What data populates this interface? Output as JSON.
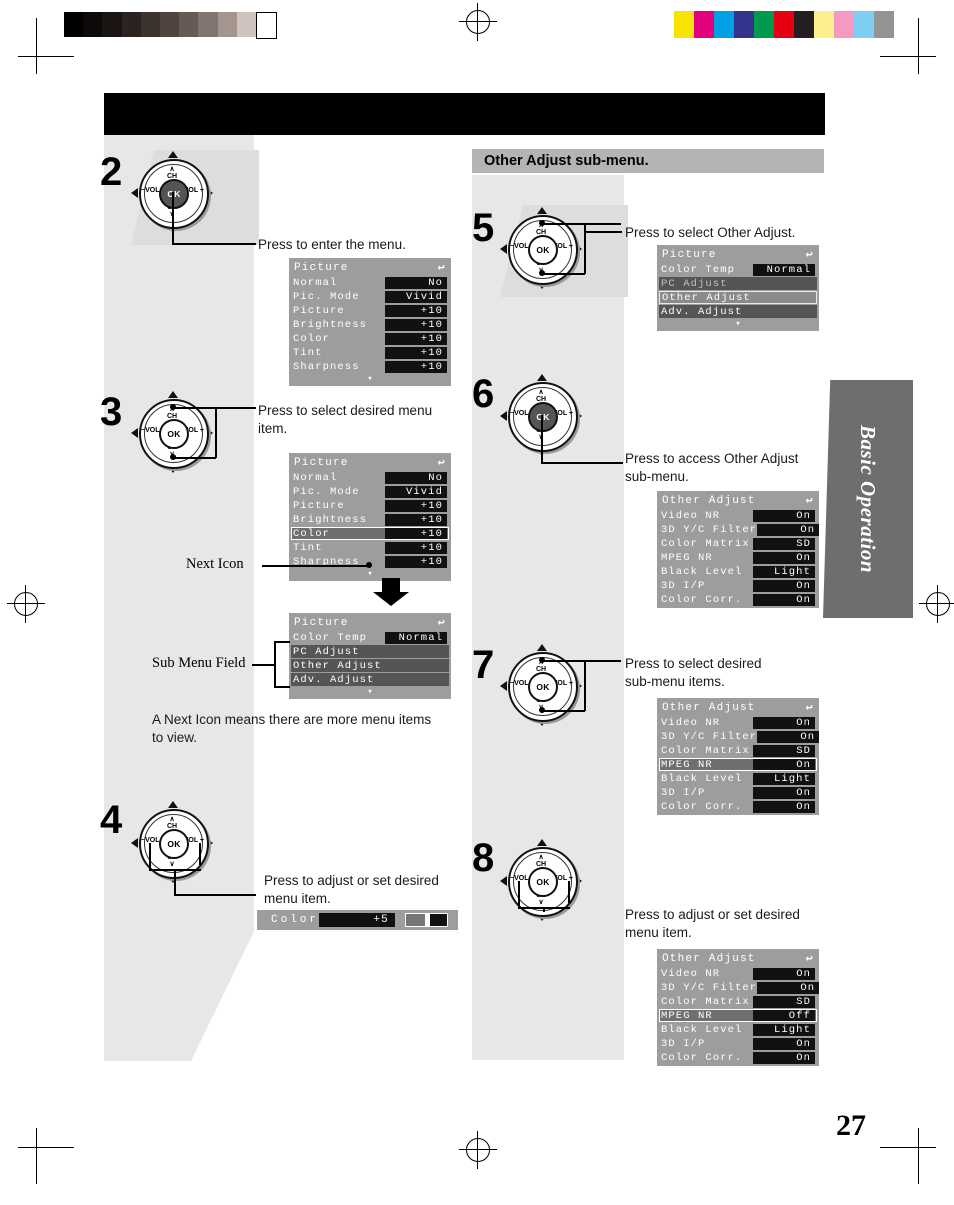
{
  "page": {
    "number": "27",
    "side_tab": "Basic Operation",
    "section_header": "Other Adjust sub-menu."
  },
  "calibration": {
    "gray_steps": [
      "#000000",
      "#0d0a09",
      "#1a1512",
      "#2b2320",
      "#3d332e",
      "#4f4440",
      "#665a55",
      "#827470",
      "#a4968f",
      "#cfc3bd",
      "#ffffff"
    ],
    "color_steps": [
      "#f7e300",
      "#e3007f",
      "#00a0e4",
      "#33358d",
      "#009a4e",
      "#e60012",
      "#231f20",
      "#fbf08c",
      "#f49ac1",
      "#7ecef4",
      "#949494"
    ]
  },
  "steps": [
    {
      "id": "step2",
      "number": "2",
      "instruction": "Press to enter the menu.",
      "remote_active": "ok"
    },
    {
      "id": "step3",
      "number": "3",
      "instruction": "Press to select desired menu\nitem.",
      "remote_active": "ch"
    },
    {
      "id": "step4",
      "number": "4",
      "instruction": "Press to adjust or set desired\nmenu item.",
      "remote_active": "vol"
    },
    {
      "id": "step5",
      "number": "5",
      "instruction": "Press to select Other Adjust.",
      "remote_active": "ch"
    },
    {
      "id": "step6",
      "number": "6",
      "instruction": "Press to access Other Adjust\nsub-menu.",
      "remote_active": "ok"
    },
    {
      "id": "step7",
      "number": "7",
      "instruction": "Press to select desired\nsub-menu items.",
      "remote_active": "ch"
    },
    {
      "id": "step8",
      "number": "8",
      "instruction": "Press to adjust or set desired\nmenu item.",
      "remote_active": "vol"
    }
  ],
  "callouts": {
    "next_icon": "Next Icon",
    "sub_menu_field": "Sub Menu Field",
    "next_icon_note": "A Next Icon means there are more menu items\nto view."
  },
  "remote": {
    "ok_label": "OK",
    "ch_up": "CH",
    "ch_up_caret": "∧",
    "ch_down": "CH",
    "ch_down_caret": "∨",
    "vol_minus": "−VOL",
    "vol_plus": "VOL +"
  },
  "osd": {
    "back_icon": "↩",
    "next_icon": "▾",
    "picture_main": {
      "title": "Picture",
      "rows": [
        {
          "key": "Normal",
          "value": "No",
          "state": "normal"
        },
        {
          "key": "Pic. Mode",
          "value": "Vivid",
          "state": "normal"
        },
        {
          "key": "Picture",
          "value": "+10",
          "state": "normal"
        },
        {
          "key": "Brightness",
          "value": "+10",
          "state": "normal"
        },
        {
          "key": "Color",
          "value": "+10",
          "state": "normal"
        },
        {
          "key": "Tint",
          "value": "+10",
          "state": "normal"
        },
        {
          "key": "Sharpness",
          "value": "+10",
          "state": "normal"
        }
      ]
    },
    "picture_main_selected": {
      "title": "Picture",
      "rows": [
        {
          "key": "Normal",
          "value": "No",
          "state": "normal"
        },
        {
          "key": "Pic. Mode",
          "value": "Vivid",
          "state": "normal"
        },
        {
          "key": "Picture",
          "value": "+10",
          "state": "normal"
        },
        {
          "key": "Brightness",
          "value": "+10",
          "state": "normal"
        },
        {
          "key": "Color",
          "value": "+10",
          "state": "selected"
        },
        {
          "key": "Tint",
          "value": "+10",
          "state": "normal"
        },
        {
          "key": "Sharpness",
          "value": "+10",
          "state": "normal"
        }
      ]
    },
    "picture_sub": {
      "title": "Picture",
      "rows": [
        {
          "key": "Color Temp",
          "value": "Normal",
          "state": "normal"
        },
        {
          "key": "PC Adjust",
          "value": "",
          "state": "field"
        },
        {
          "key": "Other Adjust",
          "value": "",
          "state": "field"
        },
        {
          "key": "Adv. Adjust",
          "value": "",
          "state": "field"
        }
      ]
    },
    "picture_sub_other_selected": {
      "title": "Picture",
      "rows": [
        {
          "key": "Color Temp",
          "value": "Normal",
          "state": "normal"
        },
        {
          "key": "PC Adjust",
          "value": "",
          "state": "dim"
        },
        {
          "key": "Other Adjust",
          "value": "",
          "state": "field-selected"
        },
        {
          "key": "Adv. Adjust",
          "value": "",
          "state": "field"
        }
      ]
    },
    "other_adjust": {
      "title": "Other Adjust",
      "rows": [
        {
          "key": "Video NR",
          "value": "On",
          "state": "normal"
        },
        {
          "key": "3D Y/C Filter",
          "value": "On",
          "state": "normal"
        },
        {
          "key": "Color Matrix",
          "value": "SD",
          "state": "normal"
        },
        {
          "key": "MPEG NR",
          "value": "On",
          "state": "normal"
        },
        {
          "key": "Black Level",
          "value": "Light",
          "state": "normal"
        },
        {
          "key": "3D I/P",
          "value": "On",
          "state": "normal"
        },
        {
          "key": "Color Corr.",
          "value": "On",
          "state": "normal"
        }
      ]
    },
    "other_adjust_selected": {
      "title": "Other Adjust",
      "rows": [
        {
          "key": "Video NR",
          "value": "On",
          "state": "normal"
        },
        {
          "key": "3D Y/C Filter",
          "value": "On",
          "state": "normal"
        },
        {
          "key": "Color Matrix",
          "value": "SD",
          "state": "normal"
        },
        {
          "key": "MPEG NR",
          "value": "On",
          "state": "selected"
        },
        {
          "key": "Black Level",
          "value": "Light",
          "state": "normal"
        },
        {
          "key": "3D I/P",
          "value": "On",
          "state": "normal"
        },
        {
          "key": "Color Corr.",
          "value": "On",
          "state": "normal"
        }
      ]
    },
    "other_adjust_changed": {
      "title": "Other Adjust",
      "rows": [
        {
          "key": "Video NR",
          "value": "On",
          "state": "normal"
        },
        {
          "key": "3D Y/C Filter",
          "value": "On",
          "state": "normal"
        },
        {
          "key": "Color Matrix",
          "value": "SD",
          "state": "normal"
        },
        {
          "key": "MPEG NR",
          "value": "Off",
          "state": "selected"
        },
        {
          "key": "Black Level",
          "value": "Light",
          "state": "normal"
        },
        {
          "key": "3D I/P",
          "value": "On",
          "state": "normal"
        },
        {
          "key": "Color Corr.",
          "value": "On",
          "state": "normal"
        }
      ]
    },
    "color_slider": {
      "label": "Color",
      "value": "+5",
      "position_pct": 46
    }
  },
  "colors": {
    "osd_background": "#9d9d9d",
    "osd_value_bg": "#111111",
    "osd_field_bg": "#555555",
    "panel_gray": "#e7e7e7",
    "header_gray": "#b4b4b4",
    "tab_gray": "#6e6e6e"
  }
}
